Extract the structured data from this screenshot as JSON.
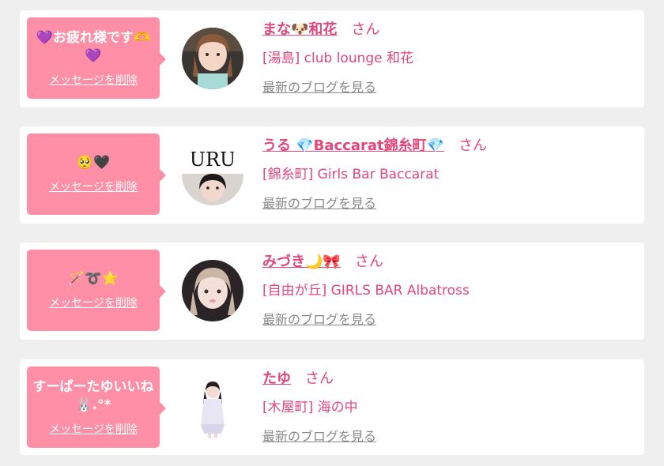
{
  "colors": {
    "background": "#efefef",
    "card": "#ffffff",
    "bubble": "#ff8fa6",
    "accent_pink": "#e2477a",
    "link_gray": "#888888"
  },
  "messages": [
    {
      "bubble_text": "💜お疲れ様です🫶💜",
      "delete_label": "メッセージを削除",
      "name": "まな🐶和花",
      "honorific": "さん",
      "shop": "[湯島] club lounge 和花",
      "blog_link": "最新のブログを見る",
      "avatar_icon": "woman-portrait-photo"
    },
    {
      "bubble_text": "🥺🖤",
      "delete_label": "メッセージを削除",
      "name": "うる 💎Baccarat錦糸町💎",
      "honorific": "さん",
      "shop": "[錦糸町] Girls Bar Baccarat",
      "blog_link": "最新のブログを見る",
      "avatar_icon": "uru-logo-portrait-photo",
      "avatar_text": "URU"
    },
    {
      "bubble_text": "🪄➰⭐️",
      "delete_label": "メッセージを削除",
      "name": "みづき🌙🎀",
      "honorific": "さん",
      "shop": "[自由が丘] GIRLS BAR Albatross",
      "blog_link": "最新のブログを見る",
      "avatar_icon": "woman-portrait-photo"
    },
    {
      "bubble_text": "すーぱーたゆいいね🐰.°*",
      "delete_label": "メッセージを削除",
      "name": "たゆ",
      "honorific": "さん",
      "shop": "[木屋町] 海の中",
      "blog_link": "最新のブログを見る",
      "avatar_icon": "woman-full-body-photo"
    }
  ]
}
